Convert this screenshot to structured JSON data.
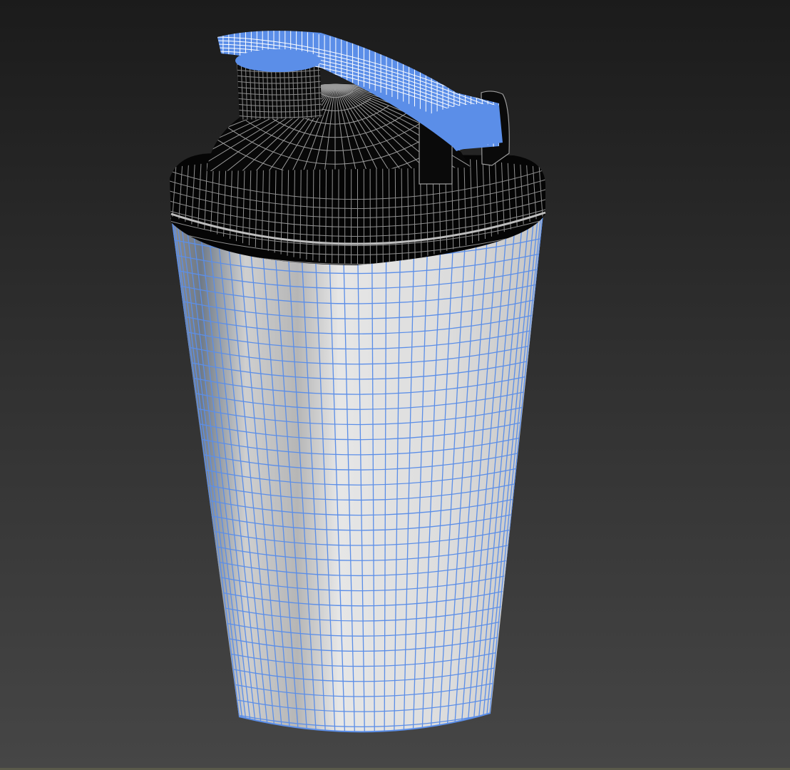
{
  "viewport": {
    "background_top": "#1b1b1b",
    "background_bottom": "#464646",
    "wire_color": "#5b8ee8",
    "selection_color": "#5b8ee8",
    "lid_color": "#000000",
    "body_color": "#d6d6d6"
  },
  "scene": {
    "object": "shaker-bottle",
    "display_mode": "shaded-with-wireframe"
  }
}
